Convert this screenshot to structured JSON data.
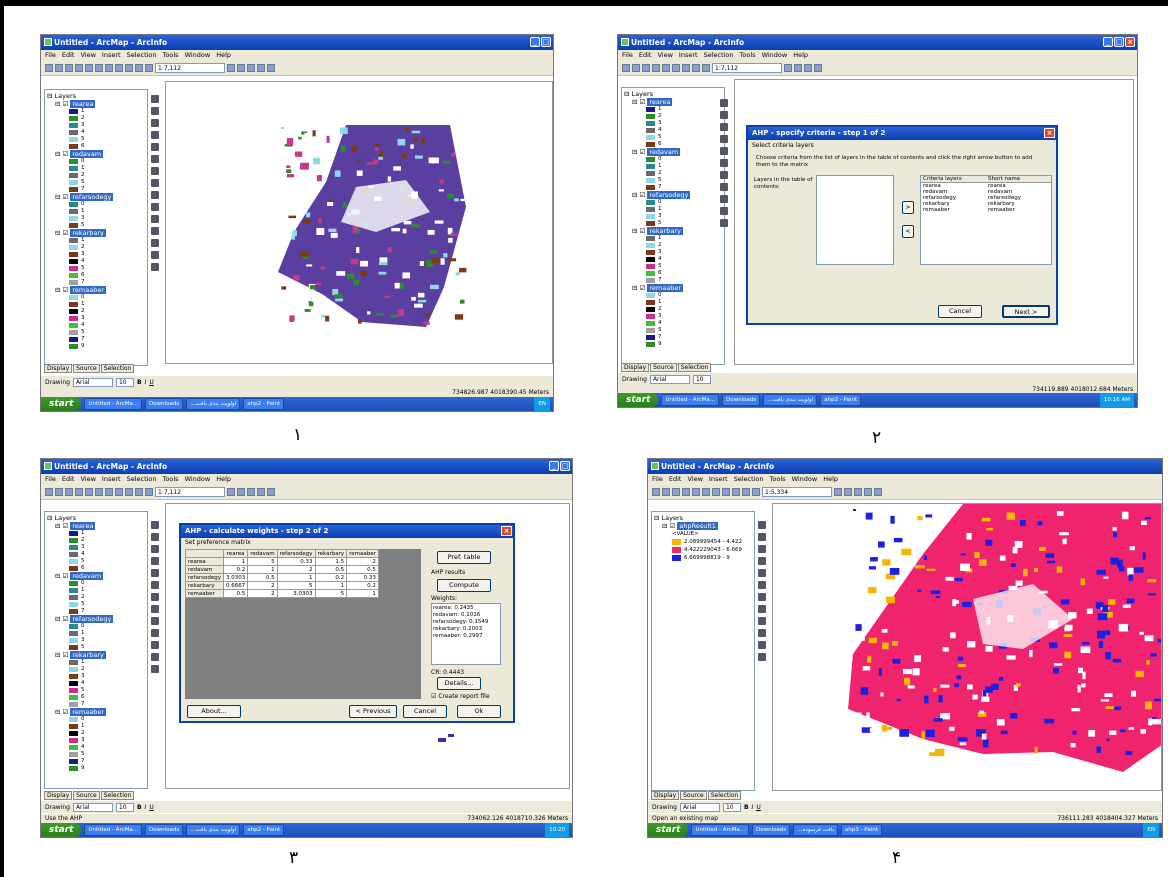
{
  "captions": [
    "١",
    "٢",
    "٣",
    "۴"
  ],
  "colors": {
    "titlebar": "#0a3fb0",
    "taskbar": "#2f66d8",
    "start": "#3c9a2c",
    "selection": "#316ac5",
    "purple": "#5b3fa0",
    "cyan": "#8ed8e8",
    "class_low": "#f2b705",
    "class_mid": "#f0246e",
    "class_high": "#1f1fe0"
  },
  "common": {
    "menu": [
      "File",
      "Edit",
      "View",
      "Insert",
      "Selection",
      "Tools",
      "Window",
      "Help"
    ],
    "scale_value": "1:7,112",
    "tabs": [
      "Display",
      "Source",
      "Selection"
    ],
    "drawing_label": "Drawing",
    "font_name": "Arial",
    "font_size": "10",
    "start_label": "start",
    "taskbar_items": [
      "Untitled - ArcMa...",
      "Downloads",
      "...اولویت بندی بافت",
      "ahp2 - Paint"
    ],
    "taskbar_lang": "EN"
  },
  "panel1": {
    "title": "Untitled - ArcMap - ArcInfo",
    "layers_label": "Layers",
    "layers": [
      {
        "name": "rearea",
        "classes": [
          "1",
          "2",
          "3",
          "4",
          "5",
          "6"
        ]
      },
      {
        "name": "redavam",
        "classes": [
          "0",
          "1",
          "2",
          "5",
          "7"
        ]
      },
      {
        "name": "refarsodegy",
        "classes": [
          "0",
          "1",
          "3",
          "5"
        ]
      },
      {
        "name": "rekarbary",
        "classes": [
          "1",
          "2",
          "3",
          "4",
          "5",
          "6",
          "7"
        ]
      },
      {
        "name": "remaaber",
        "classes": [
          "0",
          "1",
          "2",
          "3",
          "4",
          "5",
          "7",
          "9"
        ]
      }
    ],
    "status_coords": "734826.987  4018390.45 Meters"
  },
  "panel2": {
    "title": "Untitled - ArcMap - ArcInfo",
    "dialog_title": "AHP - specify criteria - step 1 of 2",
    "section_label": "Select criteria layers",
    "instruction": "Choose criteria from the list of layers in the table of contents and click the right arrow button to add them to the matrix",
    "left_list_label": "Layers in the table of contents:",
    "table_headers": [
      "Criteria layers",
      "Short name"
    ],
    "criteria": [
      {
        "layer": "rearea",
        "short": "rearea"
      },
      {
        "layer": "redavam",
        "short": "redavam"
      },
      {
        "layer": "refarsodegy",
        "short": "refarsodegy"
      },
      {
        "layer": "rekarbary",
        "short": "rekarbary"
      },
      {
        "layer": "remaaber",
        "short": "remaaber"
      }
    ],
    "add_button": ">",
    "remove_button": "<",
    "cancel_button": "Cancel",
    "next_button": "Next >",
    "layers": [
      "rearea",
      "redavam",
      "refarsodegy",
      "rekarbary",
      "remaaber"
    ],
    "status_coords": "734119.889  4018012.684 Meters",
    "clock": "10:16 AM"
  },
  "panel3": {
    "title": "Untitled - ArcMap - ArcInfo",
    "dialog_title": "AHP - calculate weights - step 2 of 2",
    "matrix_label": "Set preference matrix",
    "matrix_headers": [
      "",
      "rearea",
      "redavam",
      "refarsodegy",
      "rekarbary",
      "remaaber"
    ],
    "matrix_rows": [
      [
        "rearea",
        "1",
        "5",
        "0.33",
        "1.5",
        "2"
      ],
      [
        "redavam",
        "0.2",
        "1",
        "2",
        "0.5",
        "0.5"
      ],
      [
        "refarsodegy",
        "3.0303",
        "0.5",
        "1",
        "0.2",
        "0.33"
      ],
      [
        "rekarbary",
        "0.6667",
        "2",
        "5",
        "1",
        "0.2"
      ],
      [
        "remaaber",
        "0.5",
        "2",
        "3.0303",
        "5",
        "1"
      ]
    ],
    "pref_table_button": "Pref. table",
    "results_label": "AHP results",
    "compute_button": "Compute",
    "weights_label": "Weights:",
    "weights": [
      "rearea: 0.2435",
      "redavam: 0.1016",
      "refarsodegy: 0.1549",
      "rekarbary: 0.2003",
      "remaaber: 0.2997"
    ],
    "cr": "CR: 0.4443",
    "details_button": "Details...",
    "report_checkbox": "Create report file",
    "about_button": "About...",
    "prev_button": "< Previous",
    "cancel_button": "Cancel",
    "ok_button": "Ok",
    "layers": [
      "rearea",
      "redavam",
      "refarsodegy",
      "rekarbary",
      "remaaber"
    ],
    "status_left": "Use the AHP",
    "status_coords": "734062.126  4018710.326 Meters",
    "clock": "10:20"
  },
  "panel4": {
    "title": "Untitled - ArcMap - ArcInfo",
    "scale_value": "1:5,334",
    "layers_label": "Layers",
    "layer_name": "ahpResult1",
    "value_label": "<VALUE>",
    "legend": [
      {
        "label": "2.089999454 - 4.422",
        "color": "#f2b705"
      },
      {
        "label": "4.422229043 - 6.669",
        "color": "#f0246e"
      },
      {
        "label": "6.669998819 - 9",
        "color": "#1f1fe0"
      }
    ],
    "status_left": "Open an existing map",
    "status_coords": "736111.283  4018404.327 Meters",
    "taskbar_items": [
      "Untitled - ArcMa...",
      "Downloads",
      "...بافت فرسوده",
      "ahp3 - Paint"
    ]
  }
}
